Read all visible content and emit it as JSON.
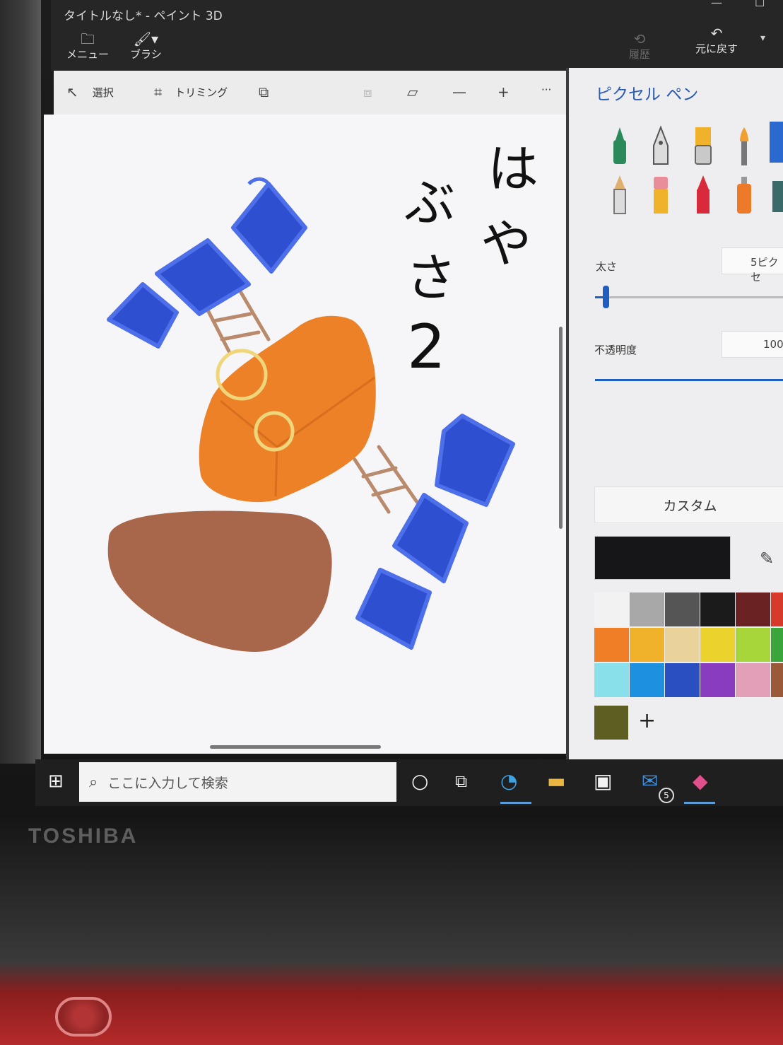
{
  "window": {
    "title": "タイトルなし* - ペイント 3D",
    "minimize": "—",
    "maximize": "☐"
  },
  "ribbon": {
    "menu_label": "メニュー",
    "brush_label": "ブラシ",
    "undo_label": "元に戻す",
    "history_label": "履歴"
  },
  "canvas_toolbar": {
    "select_label": "選択",
    "crop_label": "トリミング",
    "more_label": "···"
  },
  "canvas": {
    "handwritten_text": [
      "は",
      "や",
      "ぶ",
      "さ",
      "2"
    ]
  },
  "panel": {
    "title": "ピクセル ペン",
    "thickness_label": "太さ",
    "thickness_value": "5ピクセ",
    "opacity_label": "不透明度",
    "opacity_value": "100",
    "color_mode": "カスタム",
    "selected_color": "#161618",
    "palette": [
      [
        "#f2f2f2",
        "#a8a8a8",
        "#555555",
        "#1b1b1b",
        "#6b2222",
        "#d73a2a"
      ],
      [
        "#ef7e27",
        "#f0b22a",
        "#ead39b",
        "#ecd22d",
        "#a6d63a",
        "#3aa53a"
      ],
      [
        "#8ae0ea",
        "#1e90e0",
        "#2a4fc0",
        "#8a3cc0",
        "#e2a0b8",
        "#9a5a3a"
      ]
    ],
    "custom_color": "#5c5e22",
    "add_label": "+"
  },
  "taskbar": {
    "search_placeholder": "ここに入力して検索",
    "mail_badge": "5"
  },
  "laptop": {
    "brand": "TOSHIBA"
  }
}
